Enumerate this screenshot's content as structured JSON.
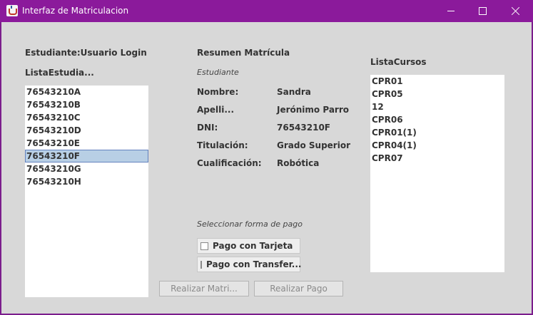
{
  "window": {
    "title": "Interfaz de Matriculacion"
  },
  "left": {
    "student_label": "Estudiante:Usuario Login",
    "list_label": "ListaEstudia...",
    "students": [
      "76543210A",
      "76543210B",
      "76543210C",
      "76543210D",
      "76543210E",
      "76543210F",
      "76543210G",
      "76543210H"
    ],
    "selected_student": "76543210F"
  },
  "summary": {
    "title": "Resumen Matrícula",
    "subtitle": "Estudiante",
    "fields": [
      {
        "label": "Nombre:",
        "value": "Sandra"
      },
      {
        "label": "Apelli...",
        "value": "Jerónimo Parro"
      },
      {
        "label": "DNI:",
        "value": "76543210F"
      },
      {
        "label": "Titulación:",
        "value": "Grado Superior"
      },
      {
        "label": "Cualificación:",
        "value": "Robótica"
      }
    ]
  },
  "payment": {
    "prompt": "Seleccionar forma de pago",
    "options": [
      {
        "label": "Pago con Tarjeta",
        "checked": false
      },
      {
        "label": "Pago con Transfer...",
        "checked": false
      }
    ]
  },
  "buttons": {
    "enroll": "Realizar Matri...",
    "pay": "Realizar Pago"
  },
  "courses": {
    "label": "ListaCursos",
    "items": [
      "CPR01",
      "CPR05",
      "12",
      "CPR06",
      "CPR01(1)",
      "CPR04(1)",
      "CPR07"
    ]
  }
}
